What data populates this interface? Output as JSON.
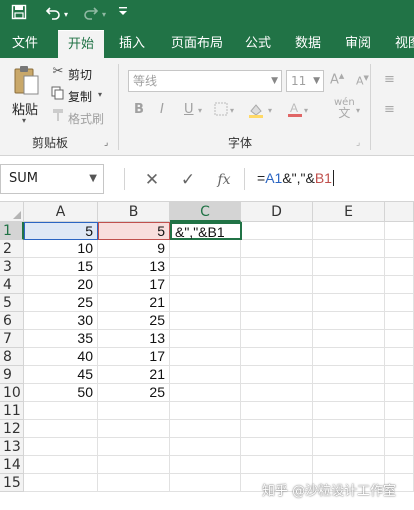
{
  "theme": {
    "accent": "#217346",
    "ref_a_color": "#2b65c2",
    "ref_b_color": "#c0504d"
  },
  "titlebar": {
    "icons": [
      "save-icon",
      "undo-icon",
      "undo-dropdown-icon",
      "redo-icon",
      "redo-dropdown-icon",
      "customize-toolbar-icon"
    ]
  },
  "menu": {
    "items": [
      "文件",
      "开始",
      "插入",
      "页面布局",
      "公式",
      "数据",
      "审阅",
      "视图"
    ],
    "active": "开始"
  },
  "ribbon": {
    "clipboard": {
      "paste_label": "粘贴",
      "cut_label": "剪切",
      "copy_label": "复制",
      "format_painter_label": "格式刷",
      "group_label": "剪贴板"
    },
    "font": {
      "font_name": "等线",
      "font_size": "11",
      "bold": "B",
      "italic": "I",
      "underline": "U",
      "group_label": "字体"
    }
  },
  "formula_bar": {
    "name_box": "SUM",
    "fx_label": "fx",
    "formula_parts": [
      "=",
      "A1",
      "&\",\"&",
      "B1"
    ]
  },
  "sheet": {
    "columns": [
      "A",
      "B",
      "C",
      "D",
      "E"
    ],
    "rows": [
      "1",
      "2",
      "3",
      "4",
      "5",
      "6",
      "7",
      "8",
      "9",
      "10",
      "11",
      "12",
      "13",
      "14",
      "15"
    ],
    "col_a": [
      "5",
      "10",
      "15",
      "20",
      "25",
      "30",
      "35",
      "40",
      "45",
      "50"
    ],
    "col_b": [
      "5",
      "9",
      "13",
      "17",
      "21",
      "25",
      "13",
      "17",
      "21",
      "25"
    ],
    "c1_text": "&\",\"&B1",
    "active_cell": "C1"
  },
  "watermark": "知乎 @沙粒设计工作室"
}
